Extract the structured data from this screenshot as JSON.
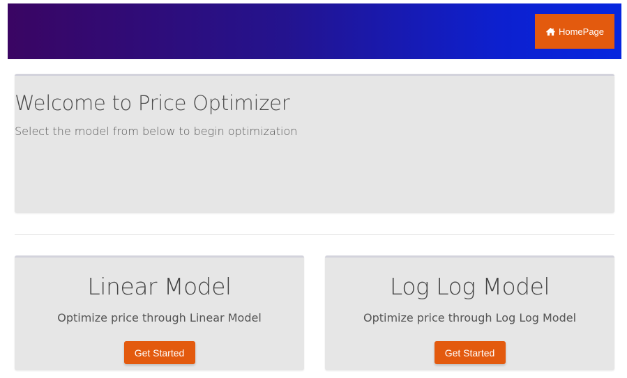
{
  "navbar": {
    "home_label": "HomePage",
    "home_icon": "home-icon",
    "gradient": [
      "#3a0563",
      "#0626df"
    ],
    "accent": "#e35a0e"
  },
  "welcome": {
    "title": "Welcome to Price Optimizer",
    "subtitle": "Select the model from below to begin optimization"
  },
  "models": [
    {
      "title": "Linear Model",
      "description": "Optimize price through Linear Model",
      "button_label": "Get Started"
    },
    {
      "title": "Log Log Model",
      "description": "Optimize price through Log Log Model",
      "button_label": "Get Started"
    }
  ]
}
